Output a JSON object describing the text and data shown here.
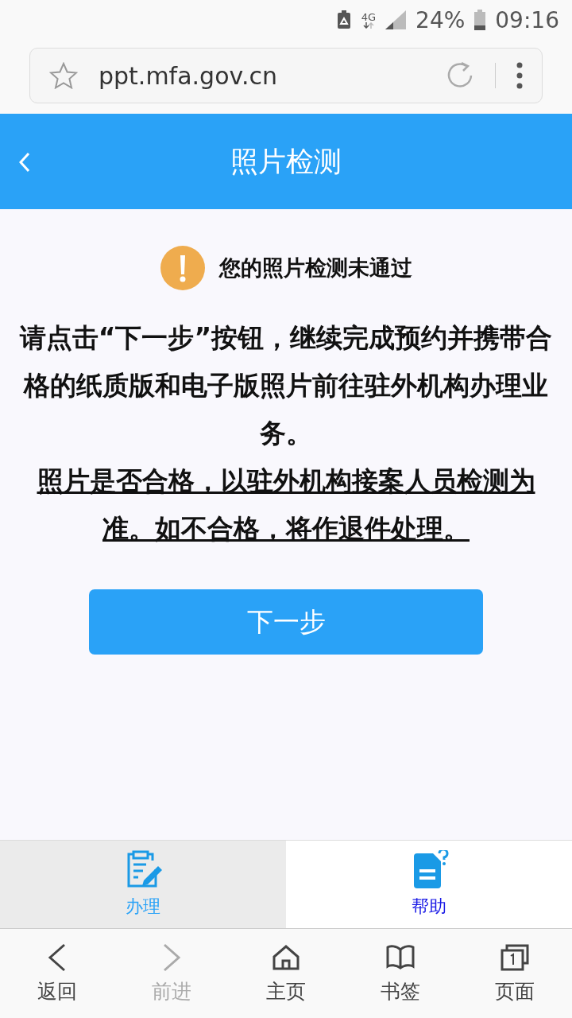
{
  "status_bar": {
    "network": "4G",
    "battery": "24%",
    "time": "09:16"
  },
  "address_bar": {
    "url": "ppt.mfa.gov.cn"
  },
  "header": {
    "title": "照片检测"
  },
  "notice": {
    "title": "您的照片检测未通过"
  },
  "paragraphs": [
    {
      "text": "请点击“下一步”按钮，继续完成预约并携带合格的纸质版和电子版照片前往驻外机构办理业务。",
      "underlined": false
    },
    {
      "text": "照片是否合格，以驻外机构接案人员检测为准。如不合格，将作退件处理。",
      "underlined": true
    }
  ],
  "next_button": "下一步",
  "tabs": [
    {
      "label": "办理",
      "kind": "form",
      "selected": true
    },
    {
      "label": "帮助",
      "kind": "help",
      "selected": false
    }
  ],
  "browser_nav": [
    {
      "label": "返回",
      "kind": "back",
      "disabled": false
    },
    {
      "label": "前进",
      "kind": "forward",
      "disabled": true
    },
    {
      "label": "主页",
      "kind": "home",
      "disabled": false
    },
    {
      "label": "书签",
      "kind": "bookmarks",
      "disabled": false
    },
    {
      "label": "页面",
      "kind": "tabs",
      "disabled": false
    }
  ]
}
